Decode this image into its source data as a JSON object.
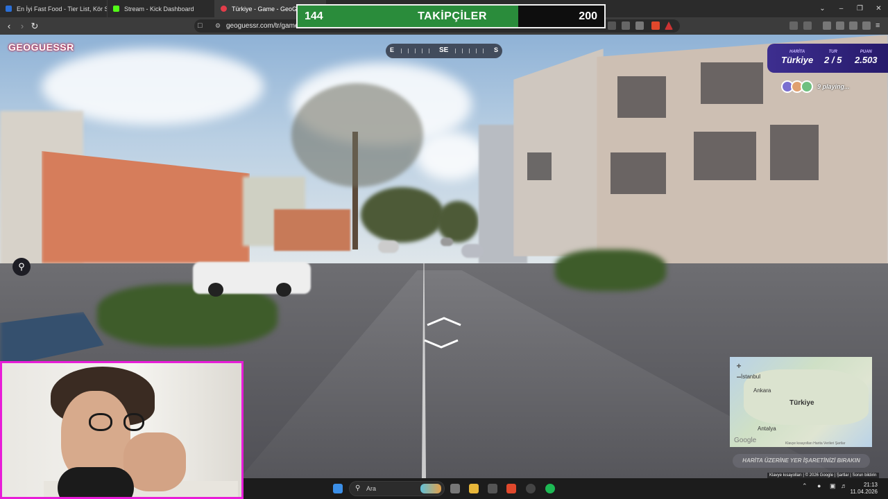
{
  "browser": {
    "tabs": [
      {
        "label": "En İyi Fast Food - Tier List, Kör Sıralama",
        "favicon_color": "#2b6fd6"
      },
      {
        "label": "Stream - Kick Dashboard",
        "favicon_color": "#53fc18"
      },
      {
        "label": "Türkiye - Game - GeoGuessr",
        "favicon_color": "#e33d4a"
      }
    ],
    "window_controls": {
      "tabs_menu": "⌄",
      "minimize": "–",
      "maximize": "❐",
      "close": "✕"
    },
    "new_tab": "+",
    "url": "geoguessr.com/tr/game/"
  },
  "follower_goal": {
    "label": "TAKİPÇİLER",
    "current": "144",
    "goal": "200",
    "progress": 0.72,
    "fill_color": "#2a8c3b"
  },
  "geoguessr": {
    "logo": "GEOGUESSR",
    "compass": {
      "left": "E",
      "center": "SE",
      "right": "S"
    },
    "stats": [
      {
        "key": "HARİTA",
        "value": "Türkiye"
      },
      {
        "key": "TUR",
        "value": "2 / 5"
      },
      {
        "key": "PUAN",
        "value": "2.503"
      }
    ],
    "players_text": "9 playing...",
    "guess_button": "HARİTA ÜZERİNE YER İŞARETİNİZİ BIRAKIN",
    "minimap": {
      "cities": [
        "İstanbul",
        "Ankara",
        "Antalya"
      ],
      "country": "Türkiye",
      "zoom_in": "+",
      "zoom_out": "−",
      "google": "Google",
      "links": "Klavye kısayolları   Harita Verileri   Şartlar"
    },
    "credits": "Klavye kısayolları  |  © 2026 Google  |  Şartlar  |  Sorun bildirin"
  },
  "taskbar": {
    "search_placeholder": "Ara",
    "time": "21:13",
    "date": "11.04.2026"
  },
  "colors": {
    "webcam_border": "#e81cd8",
    "hud_purple": "#3d2e8f",
    "brand_red": "#c0193b"
  }
}
